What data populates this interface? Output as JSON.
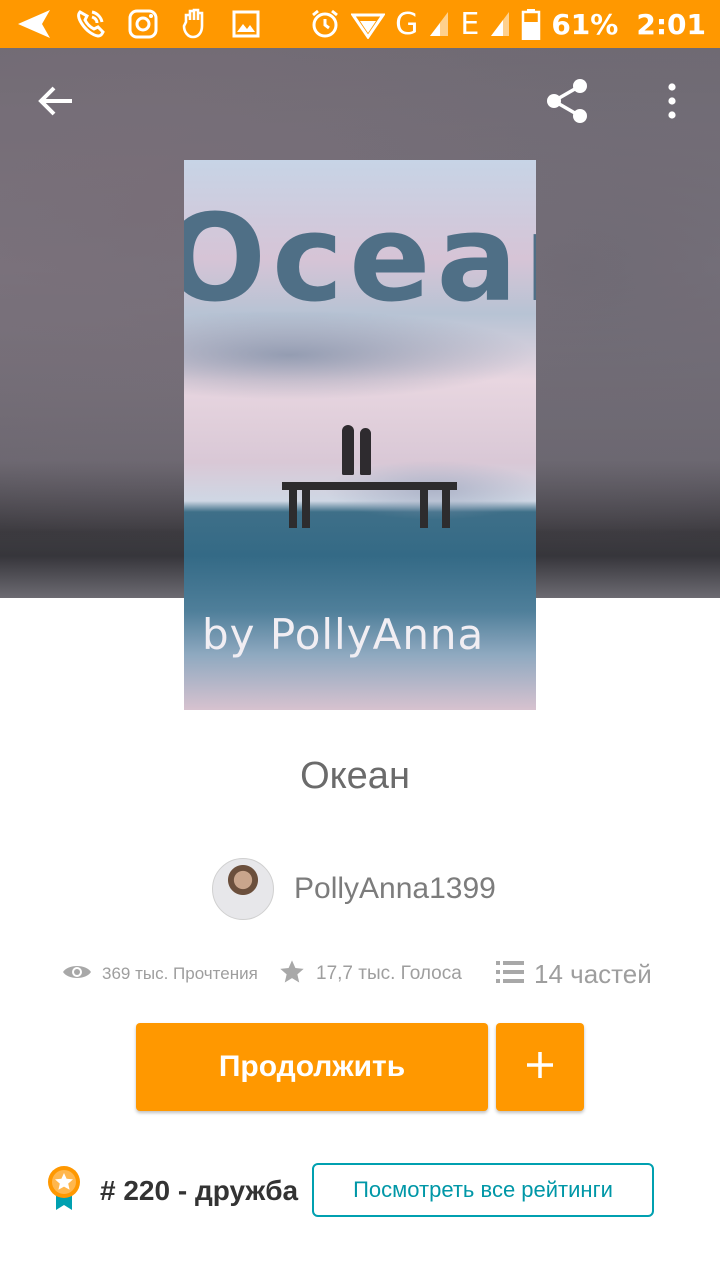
{
  "status_bar": {
    "battery": "61%",
    "time": "2:01",
    "network_g": "G",
    "network_e": "E",
    "icons": [
      "navigation-icon",
      "phone-call-icon",
      "instagram-icon",
      "hand-icon",
      "image-icon",
      "alarm-icon",
      "wifi-icon",
      "signal-icon",
      "battery-icon"
    ]
  },
  "toolbar": {
    "back_icon": "arrow-back-icon",
    "share_icon": "share-icon",
    "more_icon": "more-vert-icon"
  },
  "cover": {
    "title_text": "Ocean",
    "author_text": "by PollyAnna"
  },
  "story": {
    "title": "Океан",
    "author": "PollyAnna1399"
  },
  "stats": {
    "reads": "369 тыс. Прочтения",
    "votes": "17,7 тыс. Голоса",
    "parts": "14 частей"
  },
  "actions": {
    "continue_label": "Продолжить",
    "add_label": "+"
  },
  "ranking": {
    "text": "# 220 - дружба",
    "view_all_label": "Посмотреть все рейтинги"
  },
  "colors": {
    "accent": "#ff9800",
    "teal": "#00a0b0"
  }
}
